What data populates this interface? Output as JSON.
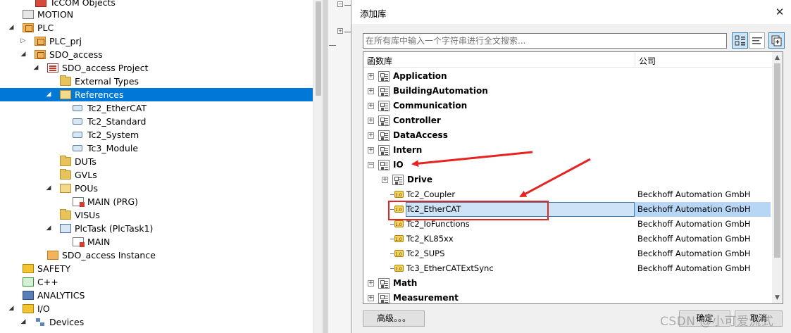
{
  "explorer": {
    "items": [
      {
        "label": "TcCOM Objects",
        "icon": "tccom-icon",
        "level": 3
      },
      {
        "label": "MOTION",
        "icon": "motion-icon"
      },
      {
        "label": "PLC",
        "icon": "plc-icon",
        "expander": "expanded"
      },
      {
        "label": "PLC_prj",
        "icon": "plc-project-icon",
        "expander": "collapsed"
      },
      {
        "label": "SDO_access",
        "icon": "plc-project-icon",
        "expander": "expanded"
      },
      {
        "label": "SDO_access Project",
        "icon": "project-icon",
        "expander": "expanded"
      },
      {
        "label": "External Types",
        "icon": "folder-icon"
      },
      {
        "label": "References",
        "icon": "folder-open-icon",
        "expander": "expanded",
        "selected": true
      },
      {
        "label": "Tc2_EtherCAT",
        "icon": "reference-icon"
      },
      {
        "label": "Tc2_Standard",
        "icon": "reference-icon"
      },
      {
        "label": "Tc2_System",
        "icon": "reference-icon"
      },
      {
        "label": "Tc3_Module",
        "icon": "reference-icon"
      },
      {
        "label": "DUTs",
        "icon": "folder-icon"
      },
      {
        "label": "GVLs",
        "icon": "folder-icon"
      },
      {
        "label": "POUs",
        "icon": "folder-open-icon",
        "expander": "expanded"
      },
      {
        "label": "MAIN (PRG)",
        "icon": "program-icon"
      },
      {
        "label": "VISUs",
        "icon": "folder-icon"
      },
      {
        "label": "PlcTask (PlcTask1)",
        "icon": "task-icon",
        "expander": "expanded"
      },
      {
        "label": "MAIN",
        "icon": "program-call-icon"
      },
      {
        "label": "SDO_access Instance",
        "icon": "instance-icon"
      },
      {
        "label": "SAFETY",
        "icon": "safety-icon"
      },
      {
        "label": "C++",
        "icon": "cpp-icon"
      },
      {
        "label": "ANALYTICS",
        "icon": "analytics-icon"
      },
      {
        "label": "I/O",
        "icon": "io-icon",
        "expander": "expanded"
      },
      {
        "label": "Devices",
        "icon": "devices-icon",
        "expander": "expanded"
      }
    ]
  },
  "dialog": {
    "title": "添加库",
    "close_glyph": "✕",
    "search_placeholder": "在所有库中输入一个字符串进行全文搜索...",
    "columns": {
      "library": "函数库",
      "company": "公司"
    },
    "rows": [
      {
        "kind": "category",
        "label": "Application",
        "toggle": "+"
      },
      {
        "kind": "category",
        "label": "BuildingAutomation",
        "toggle": "+"
      },
      {
        "kind": "category",
        "label": "Communication",
        "toggle": "+"
      },
      {
        "kind": "category",
        "label": "Controller",
        "toggle": "+"
      },
      {
        "kind": "category",
        "label": "DataAccess",
        "toggle": "+"
      },
      {
        "kind": "category",
        "label": "Intern",
        "toggle": "+"
      },
      {
        "kind": "category",
        "label": "IO",
        "toggle": "−"
      },
      {
        "kind": "subcategory",
        "label": "Drive",
        "toggle": "+"
      },
      {
        "kind": "library",
        "label": "Tc2_Coupler",
        "company": "Beckhoff Automation GmbH"
      },
      {
        "kind": "library",
        "label": "Tc2_EtherCAT",
        "company": "Beckhoff Automation GmbH",
        "selected": true
      },
      {
        "kind": "library",
        "label": "Tc2_IoFunctions",
        "company": "Beckhoff Automation GmbH"
      },
      {
        "kind": "library",
        "label": "Tc2_KL85xx",
        "company": "Beckhoff Automation GmbH"
      },
      {
        "kind": "library",
        "label": "Tc2_SUPS",
        "company": "Beckhoff Automation GmbH"
      },
      {
        "kind": "library",
        "label": "Tc3_EtherCATExtSync",
        "company": "Beckhoff Automation GmbH"
      },
      {
        "kind": "category",
        "label": "Math",
        "toggle": "+"
      },
      {
        "kind": "category",
        "label": "Measurement",
        "toggle": "+"
      }
    ],
    "buttons": {
      "advanced": "高级。。。",
      "ok": "确定",
      "cancel": "取消"
    },
    "scroll_up": "▲",
    "scroll_down": "▼"
  },
  "watermark": "CSDN @小可爱流式",
  "colors": {
    "selection": "#0078d7",
    "list_selection": "#b7d6f5",
    "annotation": "#e52421"
  }
}
